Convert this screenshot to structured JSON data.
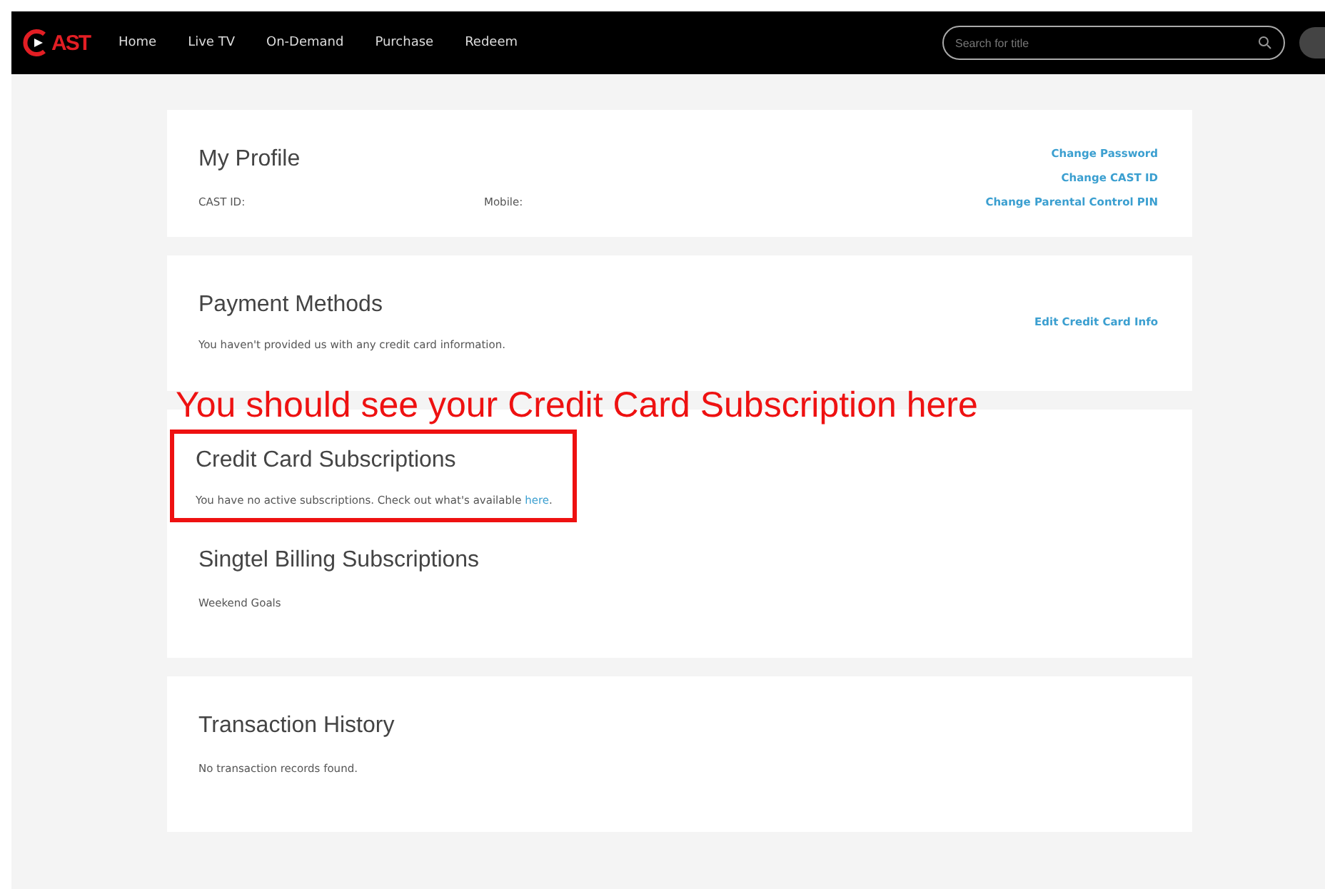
{
  "nav": {
    "logo": "AST",
    "items": [
      "Home",
      "Live TV",
      "On-Demand",
      "Purchase",
      "Redeem"
    ],
    "search": {
      "placeholder": "Search for title"
    }
  },
  "sections": [
    {
      "kind": "profile",
      "title": "My Profile",
      "fields": [
        "CAST ID:",
        "Mobile:"
      ],
      "links": [
        "Change Password",
        "Change CAST ID",
        "Change Parental Control PIN"
      ]
    },
    {
      "kind": "payment",
      "title": "Payment Methods",
      "text": "You haven't provided us with any credit card information.",
      "links": [
        "Edit Credit Card Info"
      ]
    },
    {
      "kind": "subscriptions",
      "title": "Credit Card Subscriptions",
      "text": "You have no active subscriptions. Check out what's available ",
      "link": "here",
      "tail": ".",
      "highlighted": true,
      "subtitle": "Singtel Billing Subscriptions",
      "subtext": "Weekend Goals"
    },
    {
      "kind": "history",
      "title": "Transaction History",
      "text": "No transaction records found."
    }
  ],
  "annotation": "You should see your Credit Card Subscription here"
}
